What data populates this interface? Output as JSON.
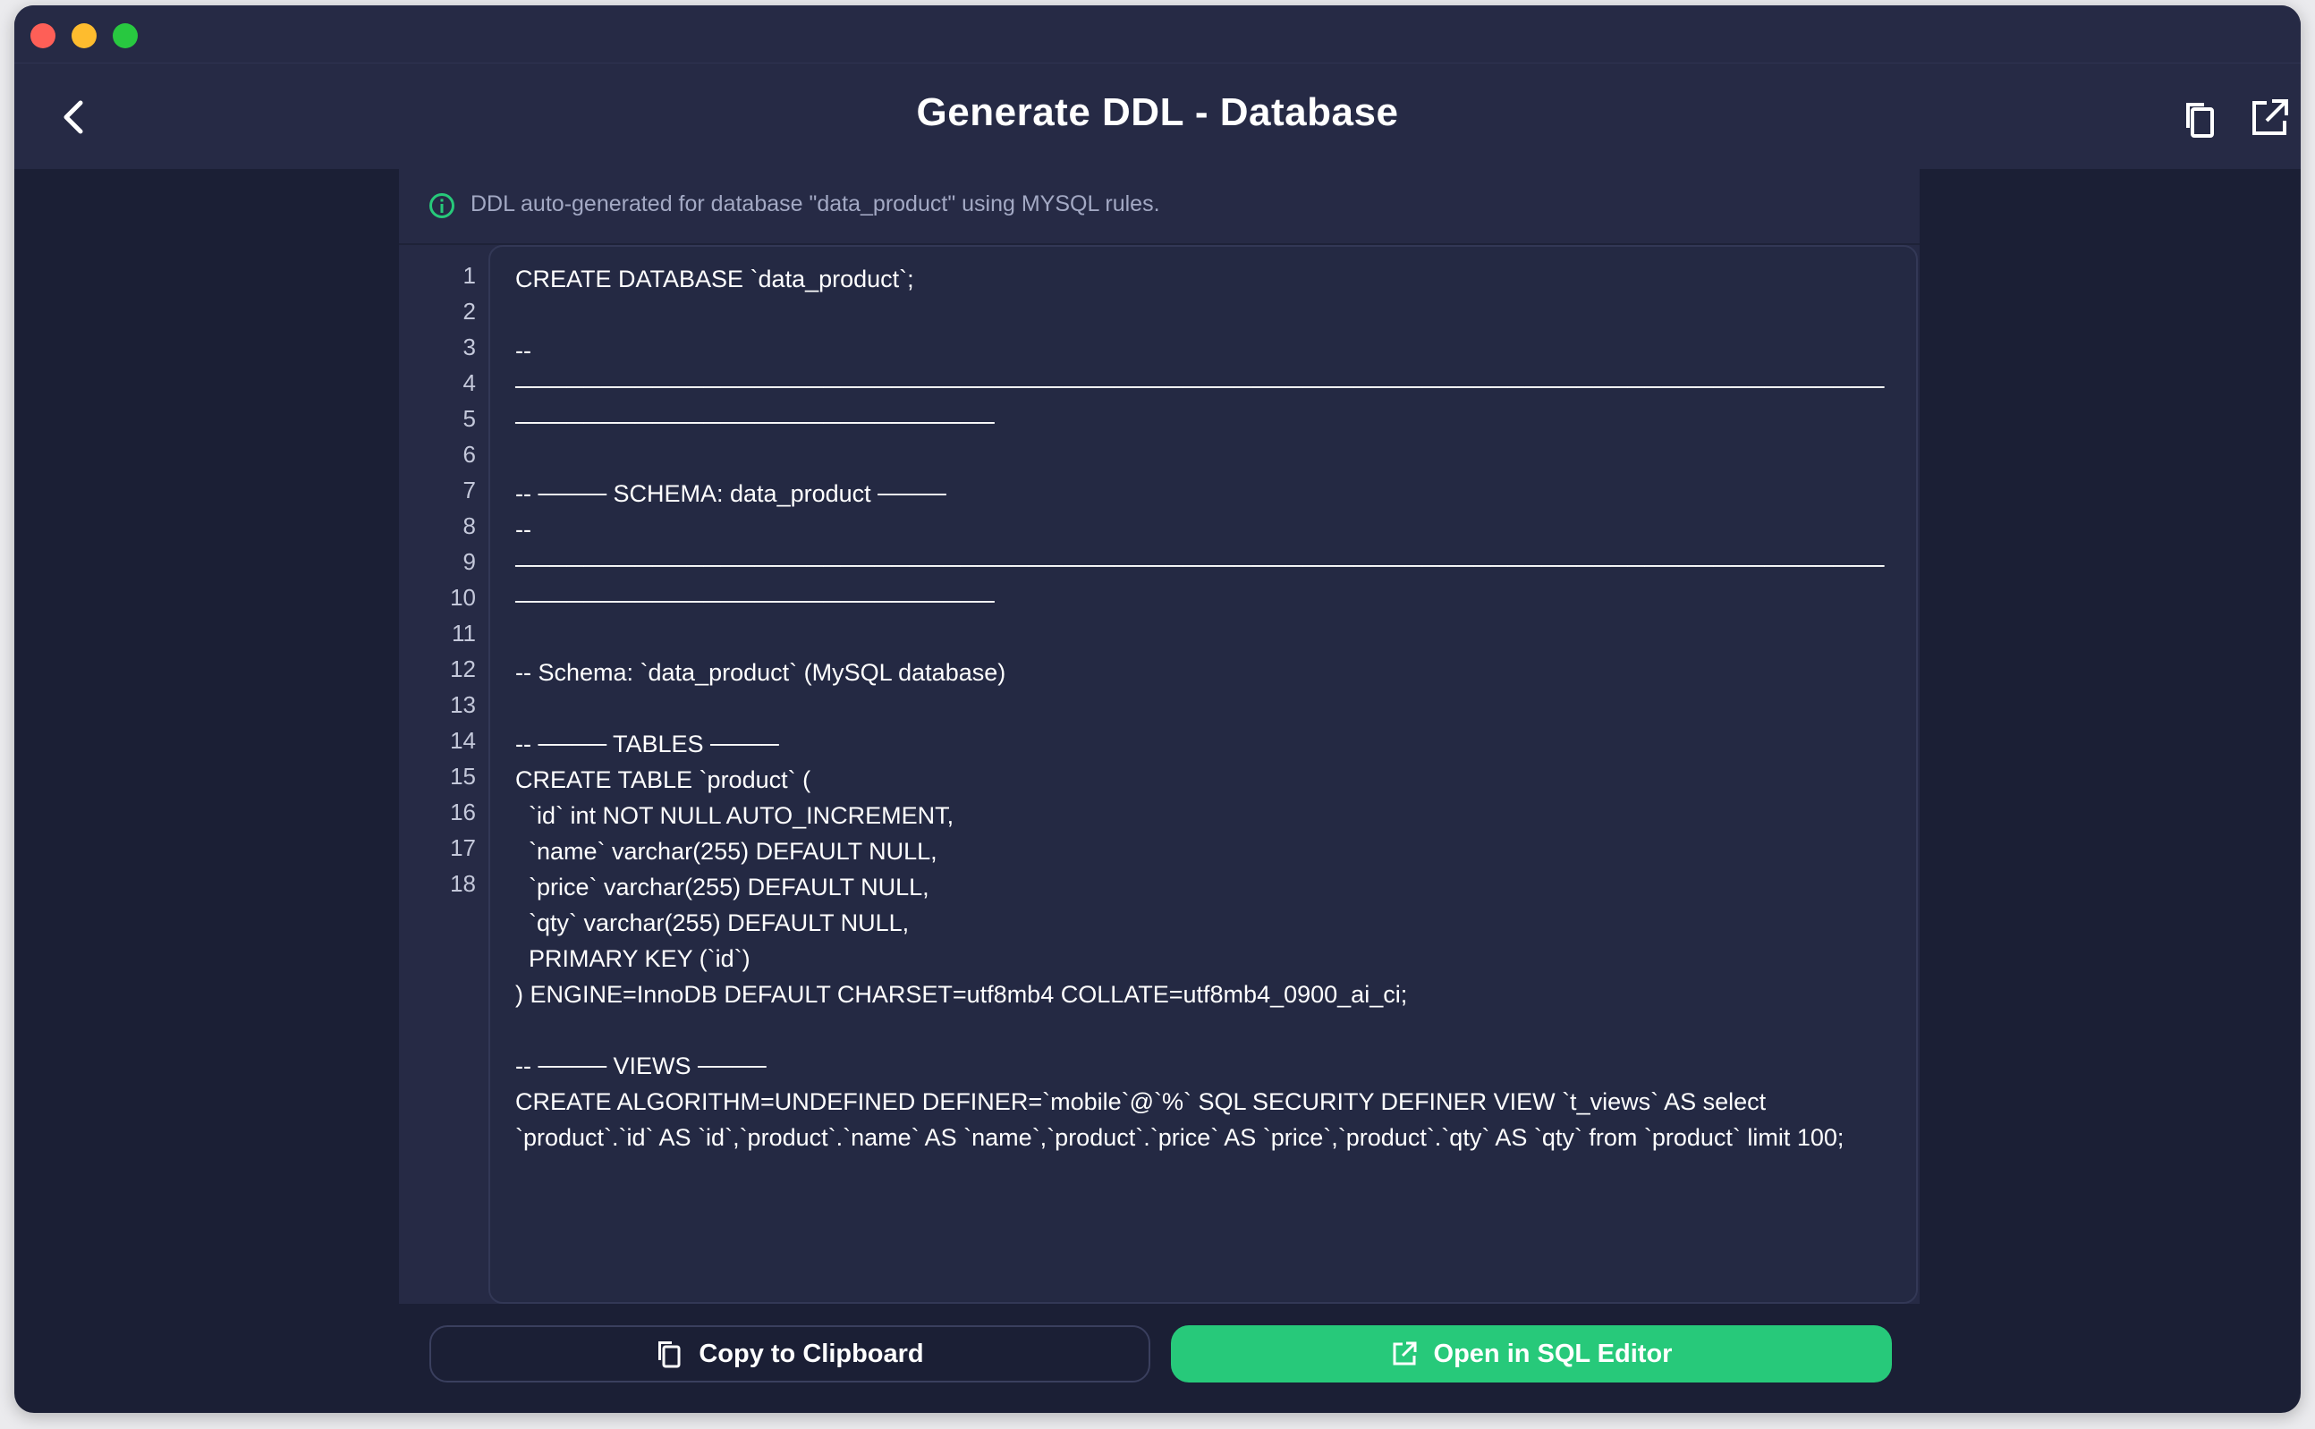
{
  "header": {
    "title": "Generate DDL - Database"
  },
  "info": {
    "message": "DDL auto-generated for database \"data_product\" using MYSQL rules."
  },
  "editor": {
    "line_numbers": [
      "1",
      "2",
      "3",
      "4",
      "5",
      "6",
      "7",
      "8",
      "9",
      "10",
      "11",
      "12",
      "13",
      "14",
      "15",
      "16",
      "17",
      "18"
    ],
    "code": "CREATE DATABASE `data_product`;\n\n-- ────────────────────────────────────────────────────────────────────────────────────────────────────────────\n\n-- ──── SCHEMA: data_product ────\n-- ────────────────────────────────────────────────────────────────────────────────────────────────────────────\n\n-- Schema: `data_product` (MySQL database)\n\n-- ──── TABLES ────\nCREATE TABLE `product` (\n  `id` int NOT NULL AUTO_INCREMENT,\n  `name` varchar(255) DEFAULT NULL,\n  `price` varchar(255) DEFAULT NULL,\n  `qty` varchar(255) DEFAULT NULL,\n  PRIMARY KEY (`id`)\n) ENGINE=InnoDB DEFAULT CHARSET=utf8mb4 COLLATE=utf8mb4_0900_ai_ci;\n\n-- ──── VIEWS ────\nCREATE ALGORITHM=UNDEFINED DEFINER=`mobile`@`%` SQL SECURITY DEFINER VIEW `t_views` AS select `product`.`id` AS `id`,`product`.`name` AS `name`,`product`.`price` AS `price`,`product`.`qty` AS `qty` from `product` limit 100;"
  },
  "actions": {
    "copy_label": "Copy to Clipboard",
    "open_label": "Open in SQL Editor"
  },
  "colors": {
    "accent_green": "#27c97a",
    "background": "#1b1f35",
    "panel": "#262a45"
  },
  "icons": {
    "back": "chevron-left-icon",
    "copy": "copy-icon",
    "open": "external-link-icon",
    "info": "info-icon"
  }
}
